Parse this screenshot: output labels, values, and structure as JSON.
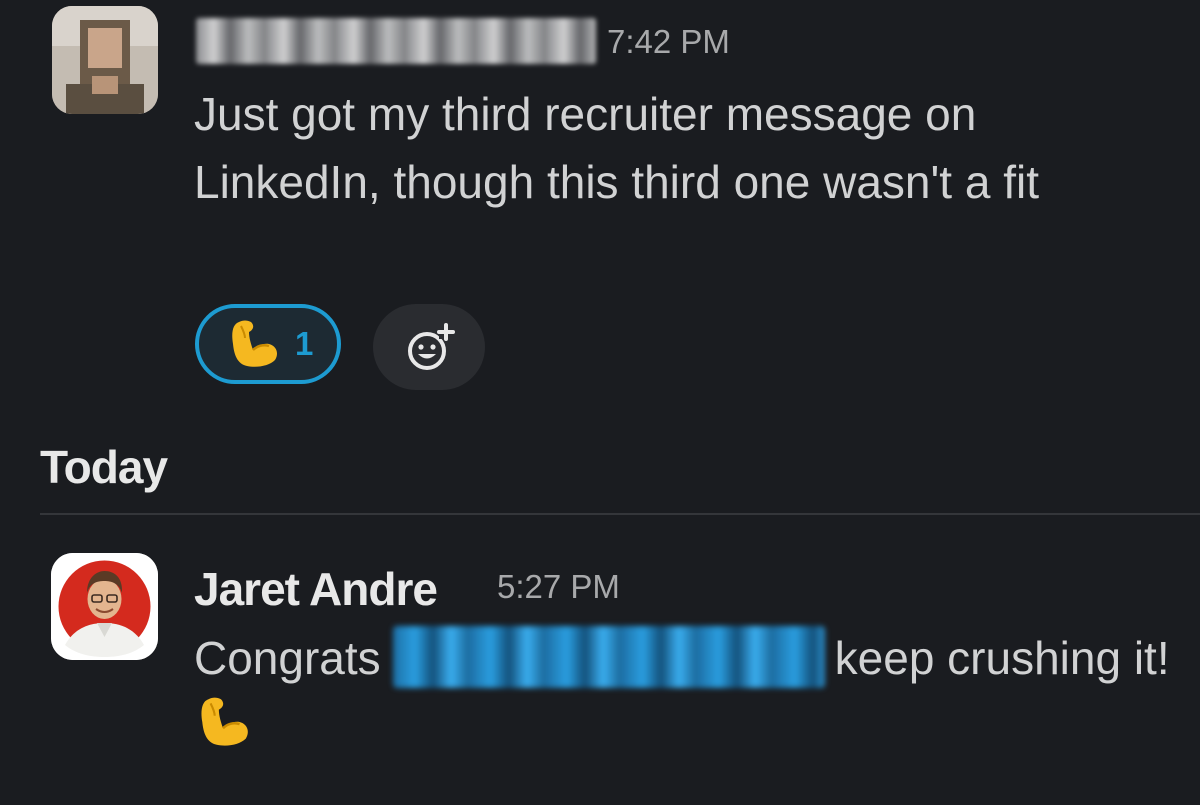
{
  "message1": {
    "author_name_redacted": true,
    "time": "7:42 PM",
    "text": "Just got my third recruiter message on LinkedIn, though this third one wasn't a fit",
    "reactions": [
      {
        "emoji": "flexed-biceps",
        "count": "1",
        "active": true
      }
    ],
    "add_reaction_icon": "add-reaction-icon"
  },
  "divider": {
    "label": "Today"
  },
  "message2": {
    "author": "Jaret Andre",
    "time": "5:27 PM",
    "text_before_mention": "Congrats",
    "mention_redacted": true,
    "text_after_mention": "keep crushing it!",
    "trailing_emoji": "flexed-biceps"
  },
  "colors": {
    "background": "#1a1c20",
    "accent": "#1d9bd1",
    "text": "#d1d2d3",
    "timestamp": "#a8a9ab"
  }
}
